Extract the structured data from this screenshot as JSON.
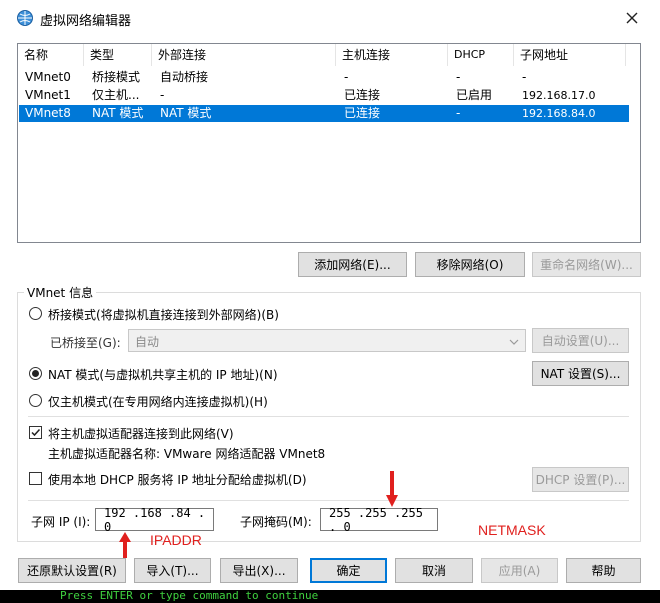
{
  "window": {
    "title": "虚拟网络编辑器"
  },
  "table": {
    "columns": [
      "名称",
      "类型",
      "外部连接",
      "主机连接",
      "DHCP",
      "子网地址"
    ],
    "rows": [
      [
        "VMnet0",
        "桥接模式",
        "自动桥接",
        "-",
        "-",
        "-"
      ],
      [
        "VMnet1",
        "仅主机...",
        "-",
        "已连接",
        "已启用",
        "192.168.17.0"
      ],
      [
        "VMnet8",
        "NAT 模式",
        "NAT 模式",
        "已连接",
        "-",
        "192.168.84.0"
      ]
    ],
    "selected_row": 2
  },
  "list_buttons": {
    "add": "添加网络(E)...",
    "remove": "移除网络(O)",
    "rename": "重命名网络(W)..."
  },
  "vmnet_info": {
    "group_title": "VMnet 信息",
    "bridged": "桥接模式(将虚拟机直接连接到外部网络)(B)",
    "bridged_to_label": "已桥接至(G):",
    "bridged_to_value": "自动",
    "auto_settings": "自动设置(U)...",
    "nat": "NAT 模式(与虚拟机共享主机的 IP 地址)(N)",
    "nat_settings": "NAT 设置(S)...",
    "host_only": "仅主机模式(在专用网络内连接虚拟机)(H)",
    "connect_adapter": "将主机虚拟适配器连接到此网络(V)",
    "adapter_name": "主机虚拟适配器名称: VMware 网络适配器 VMnet8",
    "use_dhcp": "使用本地 DHCP 服务将 IP 地址分配给虚拟机(D)",
    "dhcp_settings": "DHCP 设置(P)...",
    "subnet_ip_label": "子网 IP (I):",
    "subnet_ip": "192 .168 .84 . 0",
    "subnet_mask_label": "子网掩码(M):",
    "subnet_mask": "255 .255 .255 . 0"
  },
  "annotations": {
    "ipaddr": "IPADDR",
    "netmask": "NETMASK",
    "color": "#e0201e"
  },
  "bottom_buttons": {
    "restore": "还原默认设置(R)",
    "import": "导入(T)...",
    "export": "导出(X)...",
    "ok": "确定",
    "cancel": "取消",
    "apply": "应用(A)",
    "help": "帮助"
  },
  "terminal_text": "Press ENTER or type command to continue"
}
